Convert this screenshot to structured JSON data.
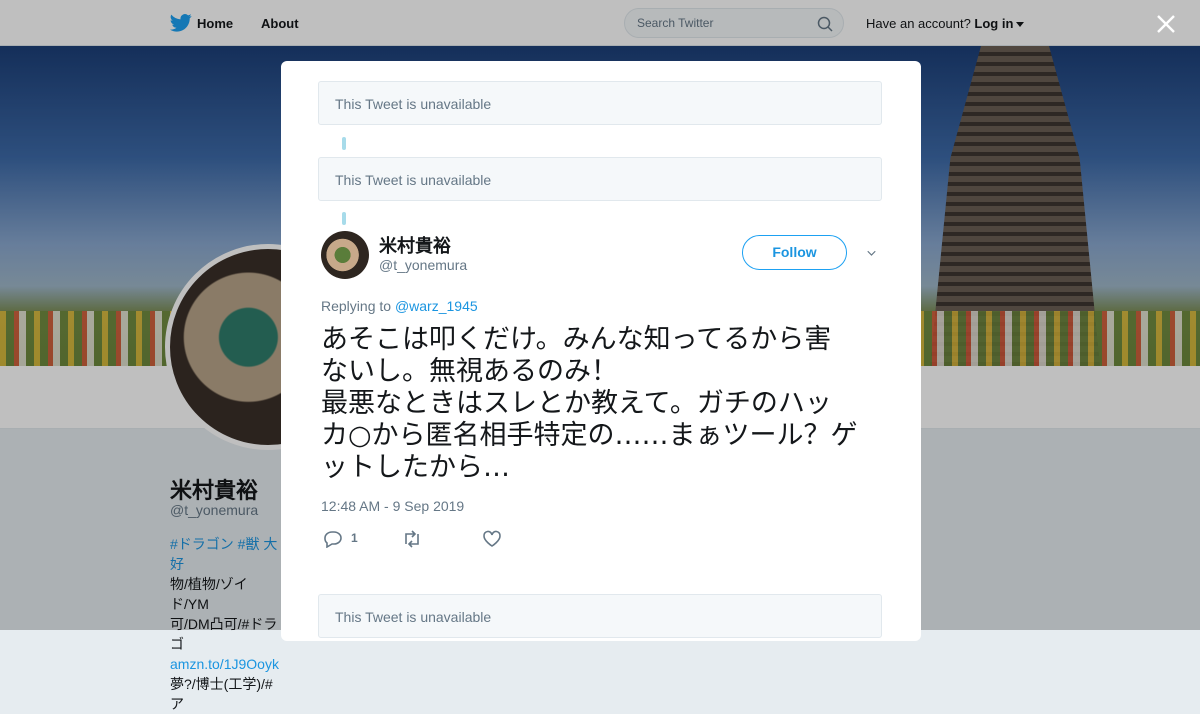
{
  "topbar": {
    "home_label": "Home",
    "about_label": "About",
    "search_placeholder": "Search Twitter",
    "have_account": "Have an account?",
    "login_label": "Log in"
  },
  "profile": {
    "name": "米村貴裕",
    "handle": "@t_yonemura",
    "bio_lines": [
      "#ドラゴン #獣 大好",
      "物/植物/ゾイド/YM",
      "可/DM凸可/#ドラゴ",
      "amzn.to/1J9Ooyk",
      "夢?/博士(工学)/#ア"
    ]
  },
  "modal": {
    "unavailable_1": "This Tweet is unavailable",
    "unavailable_2": "This Tweet is unavailable",
    "unavailable_3": "This Tweet is unavailable",
    "tweet": {
      "author_name": "米村貴裕",
      "author_handle": "@t_yonemura",
      "follow_label": "Follow",
      "replying_prefix": "Replying to",
      "replying_to": "@warz_1945",
      "text": "あそこは叩くだけ。みんな知ってるから害\nないし。無視あるのみ！\n最悪なときはスレとか教えて。ガチのハッ\nカ○から匿名相手特定の……まぁツール？ゲ\nットしたから…",
      "timestamp": "12:48 AM - 9 Sep 2019",
      "reply_count": "1"
    }
  },
  "colors": {
    "accent": "#1da1f2",
    "link": "#1b95e0",
    "muted": "#657786",
    "thread_line": "#a7dbea"
  }
}
